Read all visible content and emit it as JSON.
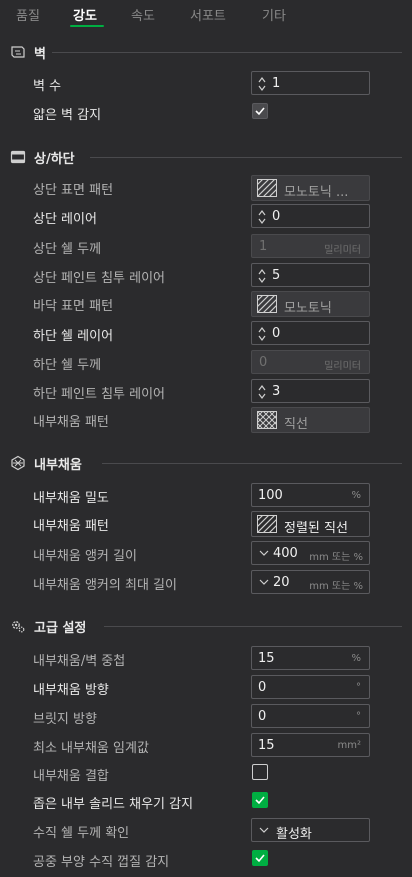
{
  "tabs": [
    {
      "label": "품질",
      "active": false
    },
    {
      "label": "강도",
      "active": true
    },
    {
      "label": "속도",
      "active": false
    },
    {
      "label": "서포트",
      "active": false
    },
    {
      "label": "기타",
      "active": false
    }
  ],
  "colors": {
    "accent": "#00ae42",
    "background": "#2b2b2d"
  },
  "sections": {
    "walls": {
      "title": "벽",
      "icon": "wall-icon",
      "rows": {
        "wall_count": {
          "label": "벽 수",
          "value": "1"
        },
        "thin_wall": {
          "label": "얇은 벽 감지",
          "checked": true
        }
      }
    },
    "top_bottom": {
      "title": "상/하단",
      "icon": "layers-icon",
      "rows": {
        "top_pattern": {
          "label": "상단 표면 패턴",
          "value": "모노토닉 ..."
        },
        "top_layers": {
          "label": "상단 레이어",
          "value": "0"
        },
        "top_shell_thickness": {
          "label": "상단 쉘 두께",
          "value": "1",
          "unit": "밀리미터"
        },
        "top_paint_layers": {
          "label": "상단 페인트 침투 레이어",
          "value": "5"
        },
        "bottom_pattern": {
          "label": "바닥 표면 패턴",
          "value": "모노토닉"
        },
        "bottom_layers": {
          "label": "하단 쉘 레이어",
          "value": "0"
        },
        "bottom_shell_thickness": {
          "label": "하단 쉘 두께",
          "value": "0",
          "unit": "밀리미터"
        },
        "bottom_paint_layers": {
          "label": "하단 페인트 침투 레이어",
          "value": "3"
        },
        "inner_pattern": {
          "label": "내부채움 패턴",
          "value": "직선"
        }
      }
    },
    "infill": {
      "title": "내부채움",
      "icon": "infill-icon",
      "rows": {
        "density": {
          "label": "내부채움 밀도",
          "value": "100",
          "unit": "%"
        },
        "pattern": {
          "label": "내부채움 패턴",
          "value": "정렬된 직선"
        },
        "anchor_length": {
          "label": "내부채움 앵커 길이",
          "value": "400",
          "unit": "mm 또는 %"
        },
        "anchor_max": {
          "label": "내부채움 앵커의 최대 길이",
          "value": "20",
          "unit": "mm 또는 %"
        }
      }
    },
    "advanced": {
      "title": "고급 설정",
      "icon": "advanced-settings-icon",
      "rows": {
        "overlap": {
          "label": "내부채움/벽 중첩",
          "value": "15",
          "unit": "%"
        },
        "direction": {
          "label": "내부채움 방향",
          "value": "0",
          "unit": "°"
        },
        "bridge_direction": {
          "label": "브릿지 방향",
          "value": "0",
          "unit": "°"
        },
        "min_threshold": {
          "label": "최소 내부채움 임계값",
          "value": "15",
          "unit": "mm²"
        },
        "combination": {
          "label": "내부채움 결합",
          "checked": false
        },
        "narrow_solid": {
          "label": "좁은 내부 솔리드 채우기 감지",
          "checked": true
        },
        "vertical_shell": {
          "label": "수직 쉘 두께 확인",
          "value": "활성화"
        },
        "floating_shell": {
          "label": "공중 부양 수직 껍질 감지",
          "checked": true
        }
      }
    }
  }
}
